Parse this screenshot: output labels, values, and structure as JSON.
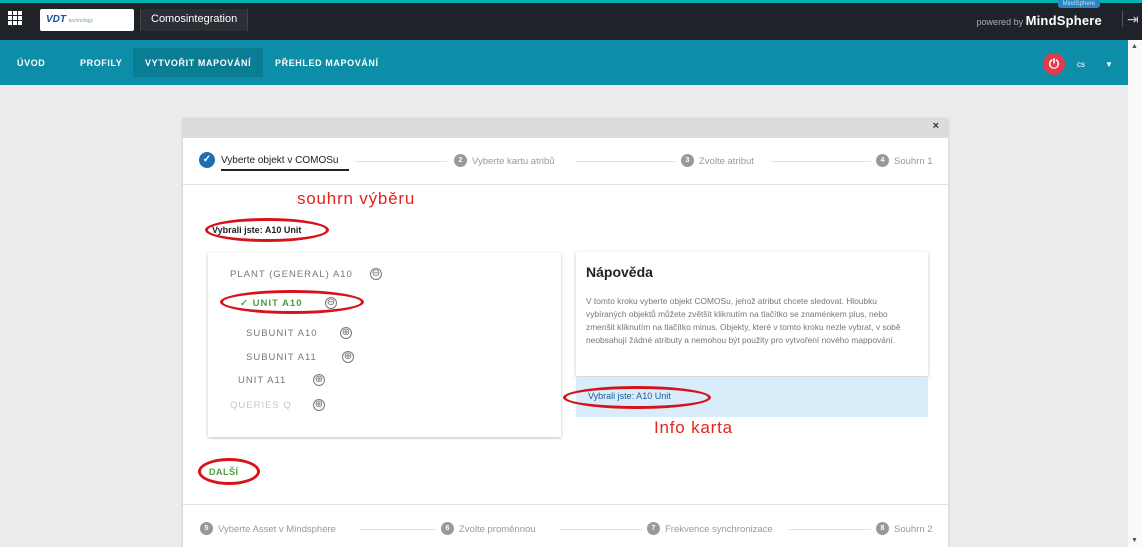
{
  "topbar": {
    "logo_text": "VDT",
    "logo_sub": "technology",
    "app_title": "Comosintegration",
    "powered_by": "powered by",
    "brand": "MindSphere",
    "badge": "MindSphere",
    "exit_icon": "exit-icon"
  },
  "nav": {
    "items": [
      "ÚVOD",
      "PROFILY",
      "VYTVOŘIT MAPOVÁNÍ",
      "PŘEHLED MAPOVÁNÍ"
    ],
    "active_index": 2,
    "lang": "cs",
    "power_icon": "power-icon"
  },
  "dialog": {
    "close": "×",
    "steps_top": [
      {
        "num": "✓",
        "label": "Vyberte objekt v COMOSu",
        "active": true
      },
      {
        "num": "2",
        "label": "Vyberte kartu atribů"
      },
      {
        "num": "3",
        "label": "Zvolte atribut"
      },
      {
        "num": "4",
        "label": "Souhrn 1"
      }
    ],
    "steps_bottom": [
      {
        "num": "5",
        "label": "Vyberte Asset v Mindsphere"
      },
      {
        "num": "6",
        "label": "Zvolte proměnnou"
      },
      {
        "num": "7",
        "label": "Frekvence synchronizace"
      },
      {
        "num": "8",
        "label": "Souhrn 2"
      }
    ],
    "selected_text": "Vybrali jste: A10 Unit",
    "tree": [
      {
        "label": "PLANT (GENERAL) A10",
        "toggle": "⊖",
        "check": ""
      },
      {
        "label": "UNIT A10",
        "toggle": "⊖",
        "check": "✓"
      },
      {
        "label": "SUBUNIT A10",
        "toggle": "⊕",
        "check": ""
      },
      {
        "label": "SUBUNIT A11",
        "toggle": "⊕",
        "check": ""
      },
      {
        "label": "UNIT A11",
        "toggle": "⊕",
        "check": ""
      },
      {
        "label": "QUERIES Q",
        "toggle": "⊕",
        "check": ""
      }
    ],
    "help_title": "Nápověda",
    "help_text": "V tomto kroku vyberte objekt COMOSu, jehož atribut chcete sledovat. Hloubku vybíraných objektů můžete zvětšit kliknutím na tlačítko se znaménkem plus, nebo zmenšit kliknutím na tlačítko minus. Objekty, které v tomto kroku nezle vybrat, v sobě neobsahují žádné atributy a nemohou být použity pro vytvoření nového mappování.",
    "info_text": "Vybrali jste: A10 Unit",
    "next_label": "DALŠÍ"
  },
  "annotations": {
    "summary": "souhrn výběru",
    "info_card": "Info karta"
  },
  "colors": {
    "topbar": "#1f2329",
    "nav": "#0d8ea8",
    "accent_teal": "#00b2b0",
    "annotation_red": "#e3231c",
    "check_green": "#4aa23a",
    "step_blue": "#1f6fb2",
    "info_bg": "#d8ecf9"
  }
}
